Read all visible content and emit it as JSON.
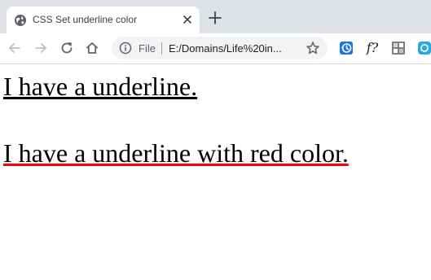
{
  "browser": {
    "tab": {
      "title": "CSS Set underline color",
      "favicon": "globe-icon",
      "close": "close-icon"
    },
    "new_tab": "plus-icon",
    "nav": {
      "back": "arrow-left-icon",
      "forward": "arrow-right-icon",
      "reload": "reload-icon",
      "home": "home-icon"
    },
    "omnibox": {
      "info_icon": "info-icon",
      "scheme_label": "File",
      "url": "E:/Domains/Life%20in...",
      "bookmark": "star-icon"
    },
    "extensions": [
      {
        "name": "history-extension-icon",
        "label": ""
      },
      {
        "name": "function-extension-icon",
        "label": "f?"
      },
      {
        "name": "puzzle-extension-icon",
        "label": ""
      },
      {
        "name": "sync-extension-icon",
        "label": ""
      }
    ]
  },
  "page": {
    "paragraphs": [
      {
        "text": "I have a underline.",
        "underline_color": "#000000"
      },
      {
        "text": "I have a underline with red color.",
        "underline_color": "#ff0000"
      }
    ]
  },
  "colors": {
    "tabstrip": "#dee1e6",
    "omnibox": "#f1f3f4",
    "red_underline": "#ff0000"
  }
}
